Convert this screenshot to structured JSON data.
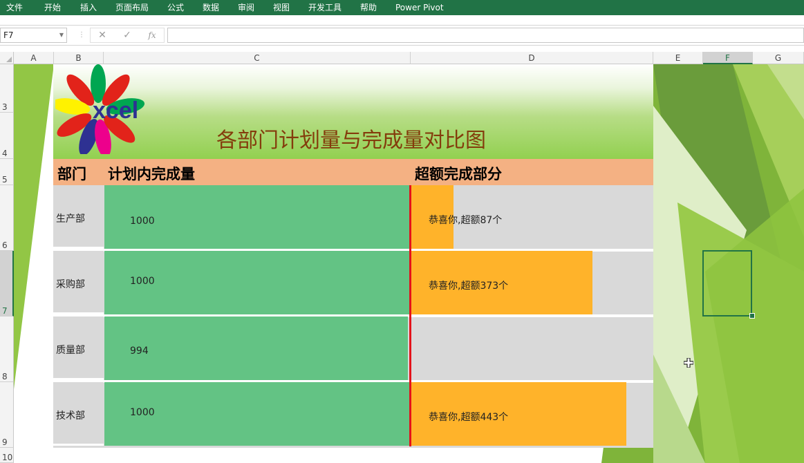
{
  "ribbon": {
    "tabs": [
      "文件",
      "开始",
      "插入",
      "页面布局",
      "公式",
      "数据",
      "审阅",
      "视图",
      "开发工具",
      "帮助",
      "Power Pivot"
    ]
  },
  "formula_bar": {
    "name_box": "F7",
    "cancel_icon": "✕",
    "enter_icon": "✓",
    "fx_label": "fx",
    "formula": ""
  },
  "columns": [
    "A",
    "B",
    "C",
    "D",
    "E",
    "F",
    "G"
  ],
  "selected_column": "F",
  "rows": [
    "3",
    "4",
    "5",
    "6",
    "7",
    "8",
    "9",
    "10"
  ],
  "selected_row": "7",
  "chart": {
    "title": "各部门计划量与完成量对比图",
    "logo_text": "xcel",
    "headers": {
      "dept": "部门",
      "plan": "计划内完成量",
      "extra": "超额完成部分"
    }
  },
  "chart_data": {
    "type": "bar",
    "title": "各部门计划量与完成量对比图",
    "categories": [
      "生产部",
      "采购部",
      "质量部",
      "技术部"
    ],
    "series": [
      {
        "name": "计划内完成量",
        "values": [
          1000,
          1000,
          994,
          1000
        ],
        "labels": [
          "1000",
          "1000",
          "994",
          "1000"
        ]
      },
      {
        "name": "超额完成部分",
        "values": [
          87,
          373,
          0,
          443
        ],
        "labels": [
          "恭喜你,超额87个",
          "恭喜你,超额373个",
          "",
          "恭喜你,超额443个"
        ]
      }
    ],
    "plan_max": 1000,
    "extra_max": 500,
    "colors": {
      "plan": "#63c384",
      "extra": "#ffb32a",
      "target_line": "#e3141b",
      "header": "#f4b183",
      "title_band": "#92d050"
    }
  }
}
